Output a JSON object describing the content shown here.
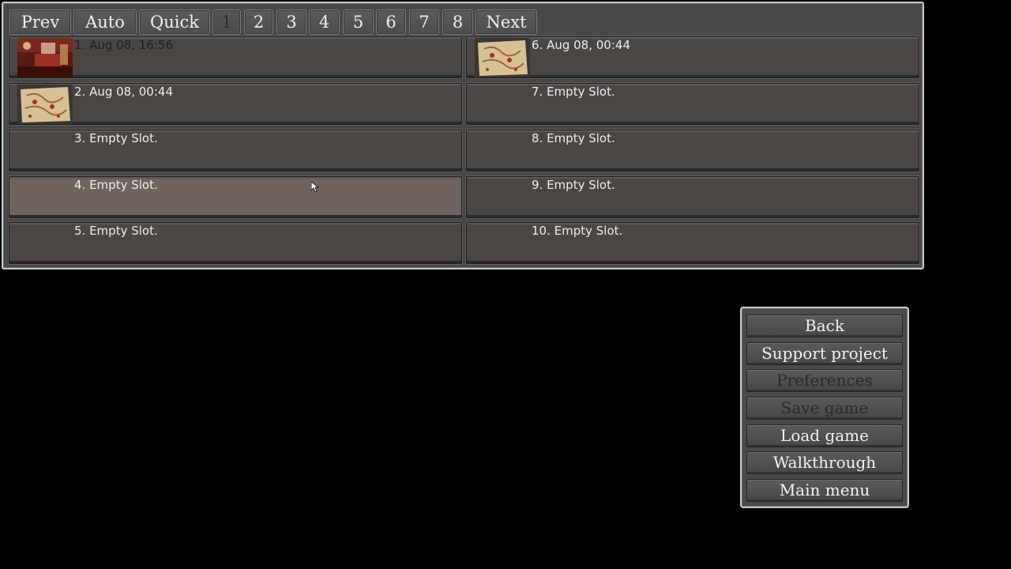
{
  "pagination": {
    "prev": "Prev",
    "auto": "Auto",
    "quick": "Quick",
    "pages": [
      "1",
      "2",
      "3",
      "4",
      "5",
      "6",
      "7",
      "8"
    ],
    "active_page": "1",
    "next": "Next"
  },
  "slots": [
    {
      "label": "1. Aug 08, 16:56",
      "has_thumbnail": true,
      "thumbnail": "room-scene",
      "text_color": "dark"
    },
    {
      "label": "2. Aug 08, 00:44",
      "has_thumbnail": true,
      "thumbnail": "map-scene"
    },
    {
      "label": "3. Empty Slot.",
      "has_thumbnail": false
    },
    {
      "label": "4. Empty Slot.",
      "has_thumbnail": false,
      "hovered": true
    },
    {
      "label": "5. Empty Slot.",
      "has_thumbnail": false
    },
    {
      "label": "6. Aug 08, 00:44",
      "has_thumbnail": true,
      "thumbnail": "map-scene"
    },
    {
      "label": "7. Empty Slot.",
      "has_thumbnail": false
    },
    {
      "label": "8. Empty Slot.",
      "has_thumbnail": false
    },
    {
      "label": "9. Empty Slot.",
      "has_thumbnail": false
    },
    {
      "label": "10. Empty Slot.",
      "has_thumbnail": false
    }
  ],
  "menu": {
    "back": "Back",
    "support": "Support project",
    "preferences": "Preferences",
    "save_game": "Save game",
    "load_game": "Load game",
    "walkthrough": "Walkthrough",
    "main_menu": "Main menu"
  },
  "colors": {
    "slot_bg": "#4b4644",
    "slot_hover_bg": "#6e635e",
    "panel_border": "#c9c9c9",
    "disabled_text": "#2a2a2a",
    "text": "#eeeeee"
  },
  "icons": {
    "cursor": "arrow-cursor-icon"
  }
}
